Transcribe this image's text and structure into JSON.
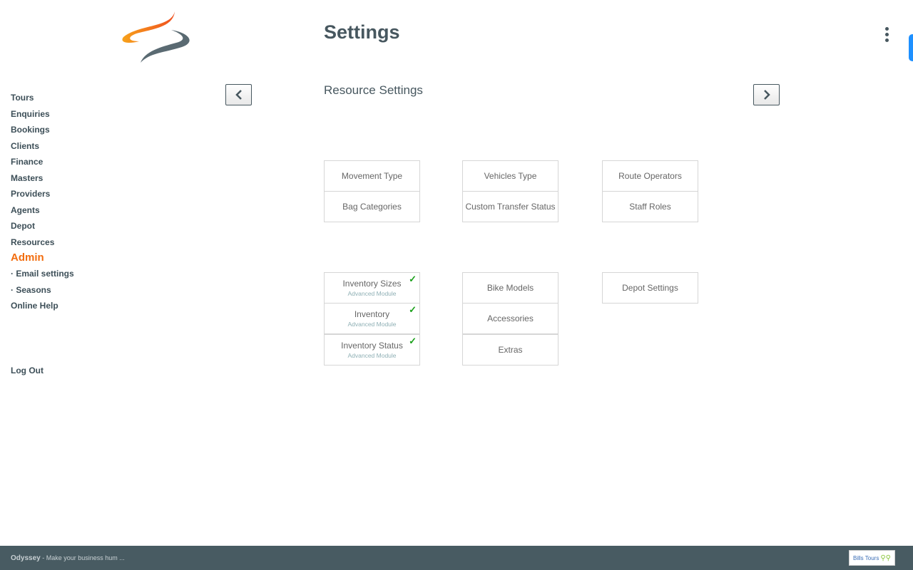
{
  "header": {
    "title": "Settings",
    "subtitle": "Resource Settings"
  },
  "sidebar": {
    "items": [
      {
        "label": "Tours"
      },
      {
        "label": "Enquiries"
      },
      {
        "label": "Bookings"
      },
      {
        "label": "Clients"
      },
      {
        "label": "Finance"
      },
      {
        "label": "Masters"
      },
      {
        "label": "Providers"
      },
      {
        "label": "Agents"
      },
      {
        "label": "Depot"
      },
      {
        "label": "Resources"
      },
      {
        "label": "Admin"
      },
      {
        "label": "· Email settings"
      },
      {
        "label": "· Seasons"
      },
      {
        "label": "Online Help"
      }
    ],
    "logout": "Log Out"
  },
  "tiles": {
    "group1": [
      [
        "Movement Type",
        "Bag Categories"
      ],
      [
        "Vehicles Type",
        "Custom Transfer Status"
      ],
      [
        "Route Operators",
        "Staff Roles"
      ]
    ],
    "group2": {
      "col1": [
        {
          "label": "Inventory Sizes",
          "sub": "Advanced Module"
        },
        {
          "label": "Inventory",
          "sub": "Advanced Module"
        },
        {
          "label": "Inventory Status",
          "sub": "Advanced Module"
        }
      ],
      "col2": [
        "Bike Models",
        "Accessories",
        "Extras"
      ],
      "col3": [
        "Depot Settings"
      ]
    }
  },
  "footer": {
    "brand": "Odyssey",
    "tagline": " - Make your business hum ...",
    "partner_logo": "Bills Tours"
  },
  "colors": {
    "accent": "#f26d0f",
    "footer": "#485b62",
    "check": "#1aa01a"
  }
}
